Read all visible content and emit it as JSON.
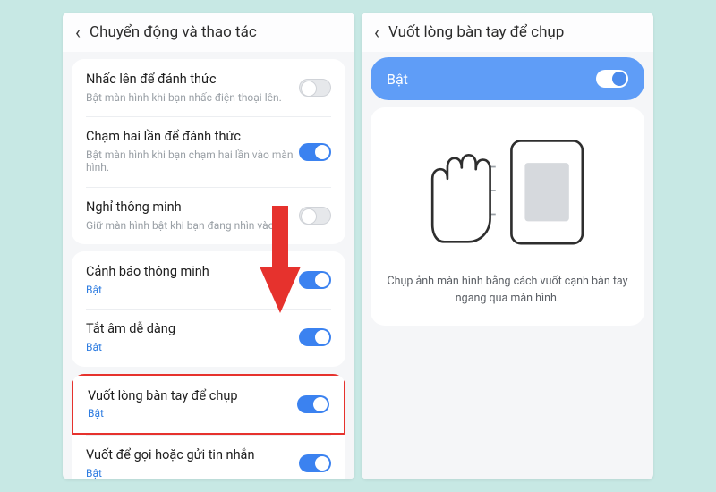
{
  "screen1": {
    "header": {
      "title": "Chuyển động và thao tác"
    },
    "group1": [
      {
        "title": "Nhấc lên để đánh thức",
        "sub": "Bật màn hình khi bạn nhấc điện thoại lên.",
        "subBlue": false,
        "on": false
      },
      {
        "title": "Chạm hai lần để đánh thức",
        "sub": "Bật màn hình khi bạn chạm hai lần vào màn hình.",
        "subBlue": false,
        "on": true
      },
      {
        "title": "Nghỉ thông minh",
        "sub": "Giữ màn hình bật khi bạn đang nhìn vào.",
        "subBlue": false,
        "on": false
      }
    ],
    "group2": [
      {
        "title": "Cảnh báo thông minh",
        "sub": "Bật",
        "subBlue": true,
        "on": true
      },
      {
        "title": "Tắt âm dễ dàng",
        "sub": "Bật",
        "subBlue": true,
        "on": true
      }
    ],
    "group3": [
      {
        "title": "Vuốt lòng bàn tay để chụp",
        "sub": "Bật",
        "subBlue": true,
        "on": true,
        "highlight": true
      },
      {
        "title": "Vuốt để gọi hoặc gửi tin nhắn",
        "sub": "Bật",
        "subBlue": true,
        "on": true
      }
    ]
  },
  "screen2": {
    "header": {
      "title": "Vuốt lòng bàn tay để chụp"
    },
    "banner": {
      "label": "Bật",
      "on": true
    },
    "caption": "Chụp ảnh màn hình bằng cách vuốt cạnh bàn tay ngang qua màn hình."
  }
}
